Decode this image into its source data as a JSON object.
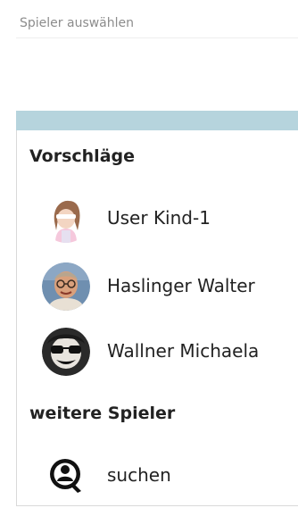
{
  "field": {
    "label": "Spieler auswählen",
    "value": ""
  },
  "suggestions": {
    "header": "Vorschläge",
    "items": [
      {
        "name": "User Kind-1",
        "avatar": "child-avatar-icon"
      },
      {
        "name": "Haslinger Walter",
        "avatar": "photo-avatar"
      },
      {
        "name": "Wallner Michaela",
        "avatar": "photo-avatar"
      }
    ]
  },
  "more": {
    "header": "weitere Spieler",
    "search_label": "suchen",
    "search_icon": "search-person-icon"
  },
  "colors": {
    "stripe": "#b6d4dd",
    "text": "#222222",
    "label": "#8c8c8c"
  }
}
